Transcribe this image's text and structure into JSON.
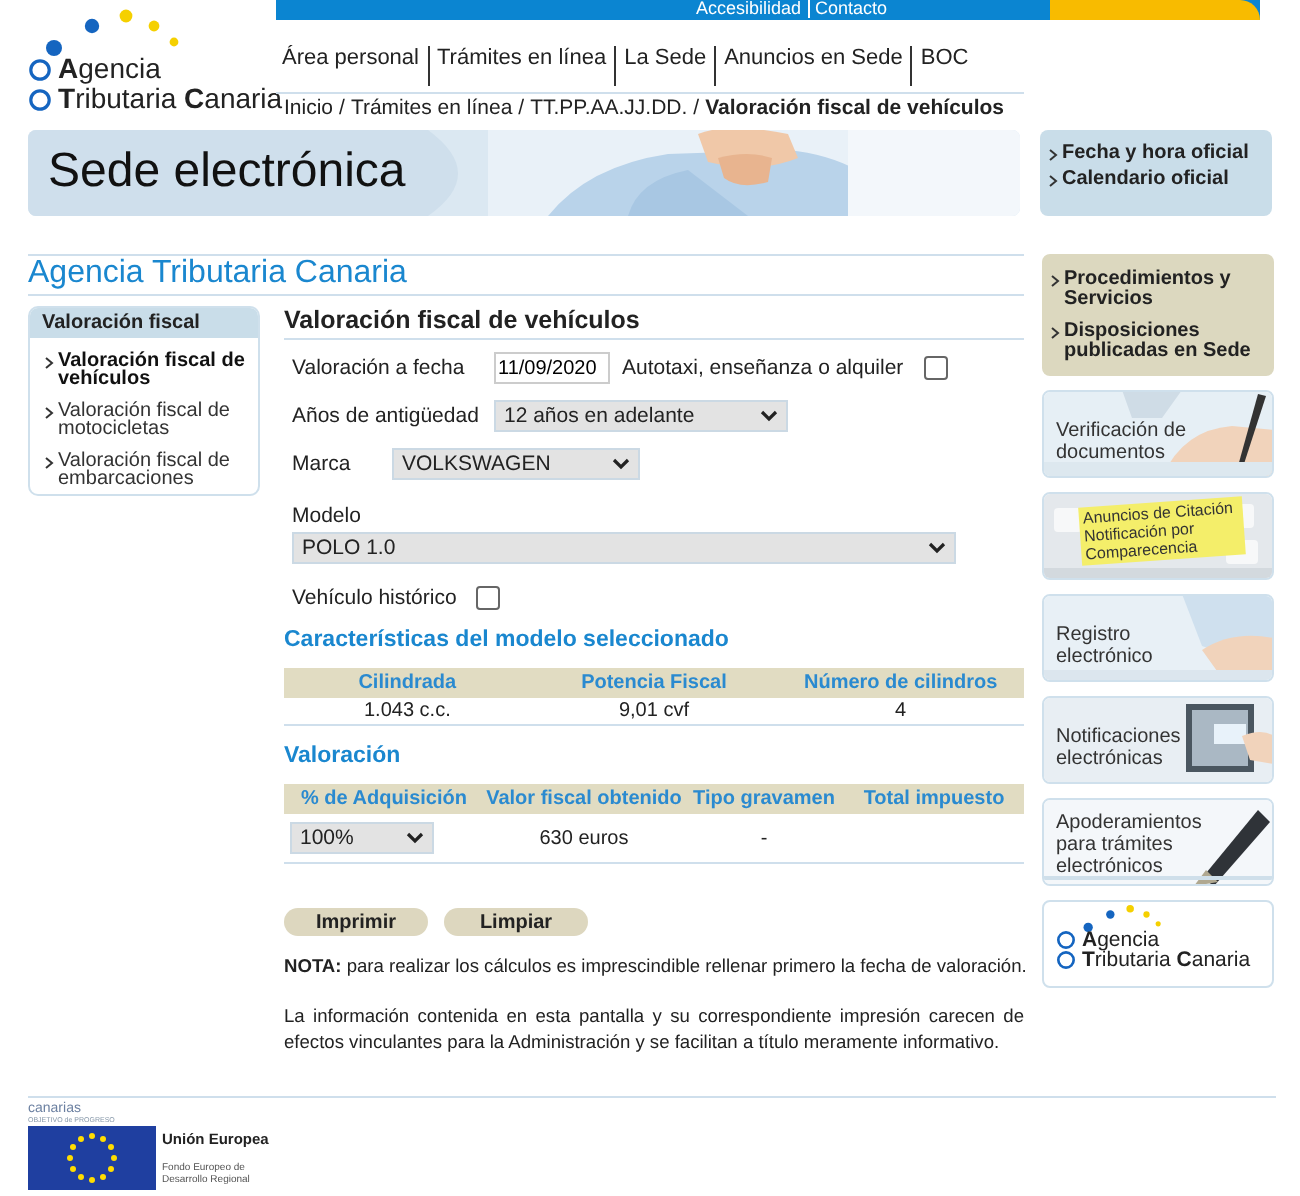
{
  "logo": {
    "line1": "**A**gencia",
    "line2": "**T**ributaria **C**anaria"
  },
  "top_links": [
    "Accesibilidad",
    "Contacto"
  ],
  "nav": [
    "Área personal",
    "Trámites en línea",
    "La Sede",
    "Anuncios en Sede",
    "BOC"
  ],
  "breadcrumb": [
    {
      "label": "Inicio",
      "separator": "/",
      "current": false
    },
    {
      "label": "Trámites en línea",
      "separator": "/",
      "current": false
    },
    {
      "label": "TT.PP.AA.JJ.DD.",
      "separator": "/",
      "current": false
    },
    {
      "label": "Valoración fiscal de vehículos",
      "current": true
    }
  ],
  "banner": {
    "title": "Sede electrónica"
  },
  "quick_links": [
    "Fecha y hora oficial",
    "Calendario oficial"
  ],
  "page_title": "Agencia Tributaria Canaria",
  "sidebar": {
    "title": "Valoración fiscal",
    "items": [
      {
        "label": "Valoración fiscal de vehículos",
        "selected": true
      },
      {
        "label": "Valoración fiscal de motocicletas",
        "selected": false
      },
      {
        "label": "Valoración fiscal de embarcaciones",
        "selected": false
      }
    ]
  },
  "form": {
    "title": "Valoración fiscal de vehículos",
    "date_label": "Valoración a fecha",
    "date_value": "11/09/2020",
    "autotaxi": {
      "label": "Autotaxi, enseñanza o alquiler",
      "checked": false
    },
    "age_label": "Años de antigüedad",
    "age_value": "12 años en adelante",
    "brand_label": "Marca",
    "brand_value": "VOLKSWAGEN",
    "model_label": "Modelo",
    "model_value": "POLO 1.0",
    "historic": {
      "label": "Vehículo histórico",
      "checked": false
    }
  },
  "characteristics": {
    "title": "Características del modelo seleccionado",
    "columns": [
      "Cilindrada",
      "Potencia Fiscal",
      "Número de cilindros"
    ],
    "row": [
      "1.043 c.c.",
      "9,01 cvf",
      "4"
    ]
  },
  "valuation": {
    "title": "Valoración",
    "columns": [
      "% de Adquisición",
      "Valor fiscal obtenido",
      "Tipo gravamen",
      "Total impuesto"
    ],
    "acquisition": "100%",
    "fiscal_value": "630 euros",
    "rate": "-"
  },
  "buttons": [
    "Imprimir",
    "Limpiar"
  ],
  "note": "**NOTA:** para realizar los cálculos es imprescindible rellenar primero la fecha de valoración.",
  "disclaimer": "La información contenida en esta pantalla y su correspondiente impresión carecen de efectos vinculantes para la Administración y se facilitan a título meramente informativo.",
  "right_links": [
    "Procedimientos y Servicios",
    "Disposiciones publicadas en Sede"
  ],
  "tiles": [
    {
      "kind": "pen",
      "label": "Verificación de documentos"
    },
    {
      "kind": "note",
      "label": "Anuncios de Citación Notificación por Comparecencia"
    },
    {
      "kind": "hands",
      "label": "Registro electrónico"
    },
    {
      "kind": "screen",
      "label": "Notificaciones electrónicas"
    },
    {
      "kind": "nib",
      "label": "Apoderamientos para trámites electrónicos"
    },
    {
      "kind": "logo",
      "line1": "**A**gencia",
      "line2": "**T**ributaria **C**anaria"
    }
  ],
  "footer": {
    "brand": "canarias",
    "tagline": "OBJETIVO de PROGRESO",
    "eu": "Unión Europea",
    "fund": "Fondo Europeo de Desarrollo Regional"
  }
}
